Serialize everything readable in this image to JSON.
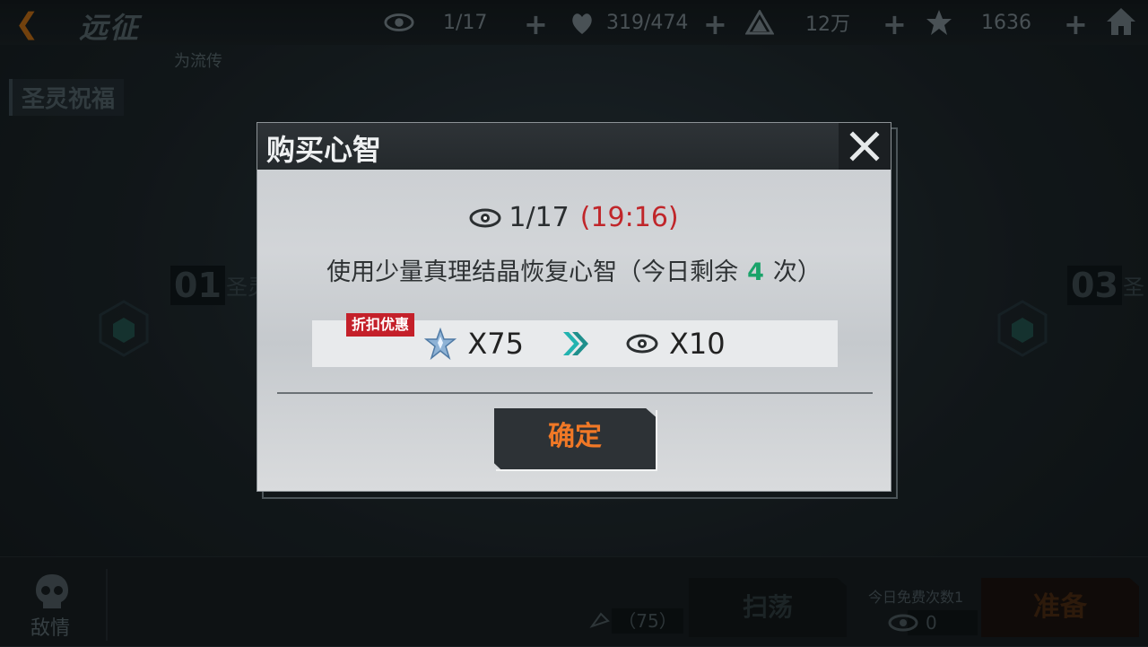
{
  "header": {
    "title": "远征",
    "subtitle": "为流传",
    "resources": [
      {
        "icon": "eye-icon",
        "value": "1/17"
      },
      {
        "icon": "heart-fist-icon",
        "value": "319/474"
      },
      {
        "icon": "pyramid-icon",
        "value": "12万"
      },
      {
        "icon": "crystal-star-icon",
        "value": "1636"
      }
    ]
  },
  "left_panel": {
    "label": "圣灵祝福"
  },
  "stages": [
    {
      "number": "01",
      "name": "圣灵 森林"
    },
    {
      "number": "03",
      "name": "圣"
    }
  ],
  "bottom": {
    "enemy_label": "敌情",
    "cost": "（75）",
    "sweep_label": "扫荡",
    "free_label": "今日免费次数1",
    "free_count": "0",
    "prepare_label": "准备"
  },
  "modal": {
    "title": "购买心智",
    "stamina": "1/17",
    "timer": "(19:16)",
    "desc_before": "使用少量真理结晶恢复心智（今日剩余",
    "remaining": "4",
    "desc_after": "次）",
    "discount_tag": "折扣优惠",
    "cost": "X75",
    "gain": "X10",
    "confirm_label": "确定"
  },
  "colors": {
    "accent_orange": "#f07826",
    "timer_red": "#c0262a",
    "remaining_green": "#1aa36a",
    "discount_red": "#c4202a",
    "arrow_teal": "#22b3b0"
  }
}
